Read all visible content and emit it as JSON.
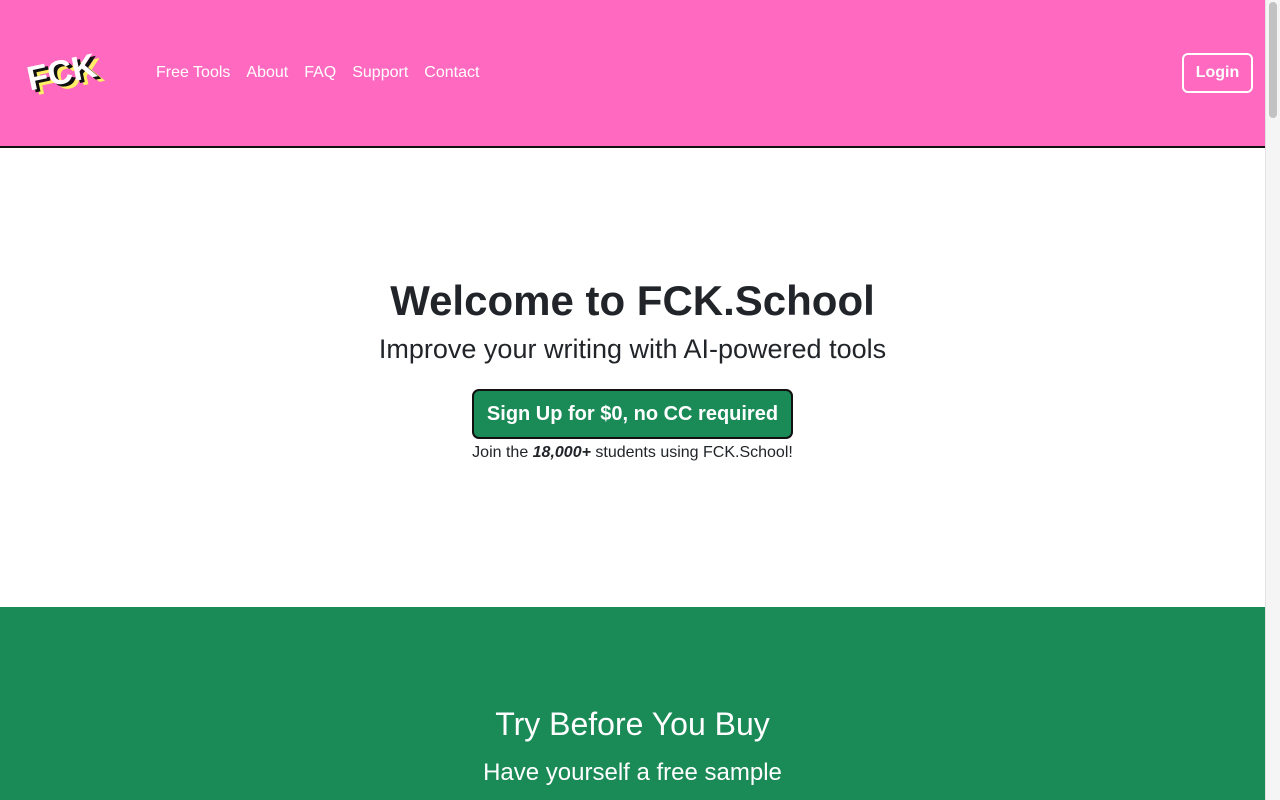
{
  "header": {
    "logo_text": "FCK",
    "nav": [
      "Free Tools",
      "About",
      "FAQ",
      "Support",
      "Contact"
    ],
    "login_label": "Login"
  },
  "hero": {
    "title": "Welcome to FCK.School",
    "subtitle": "Improve your writing with AI-powered tools",
    "signup_label": "Sign Up for $0, no CC required",
    "join_prefix": "Join the ",
    "join_count": "18,000+",
    "join_suffix": " students using FCK.School!"
  },
  "trial": {
    "title": "Try Before You Buy",
    "subtitle": "Have yourself a free sample"
  },
  "colors": {
    "header_bg": "#ff69c0",
    "accent_green": "#1a8a57",
    "text_dark": "#212529",
    "logo_shadow_black": "#111111",
    "logo_shadow_yellow": "#ffee66"
  }
}
